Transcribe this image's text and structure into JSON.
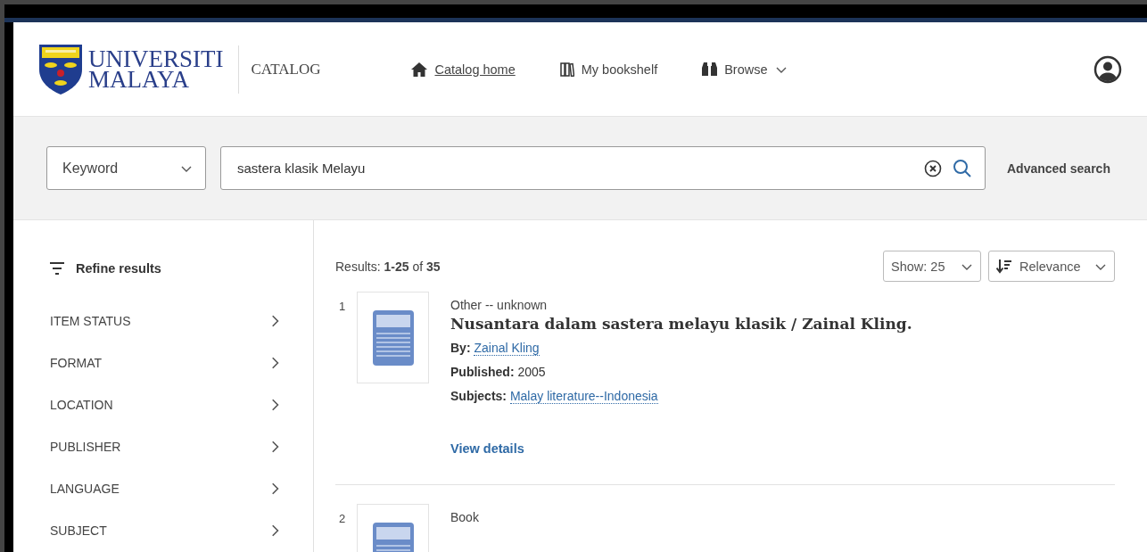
{
  "header": {
    "logo": {
      "line_1": "UNIVERSITI",
      "line_2": "MALAYA"
    },
    "section": "CATALOG",
    "nav": [
      {
        "label": "Catalog home",
        "selected": true,
        "has_menu": false
      },
      {
        "label": "My bookshelf",
        "selected": false,
        "has_menu": false
      },
      {
        "label": "Browse",
        "selected": false,
        "has_menu": true
      }
    ]
  },
  "search": {
    "field_type": "Keyword",
    "query": "sastera klasik Melayu",
    "advanced": "Advanced search"
  },
  "sidebar": {
    "title": "Refine results",
    "facets": [
      {
        "label": "ITEM STATUS",
        "expanded": false
      },
      {
        "label": "FORMAT",
        "expanded": false
      },
      {
        "label": "LOCATION",
        "expanded": false
      },
      {
        "label": "PUBLISHER",
        "expanded": false
      },
      {
        "label": "LANGUAGE",
        "expanded": false
      },
      {
        "label": "SUBJECT",
        "expanded": false
      }
    ]
  },
  "results": {
    "summary": "Results: **1-25** of **35**",
    "show": "Show: 25",
    "sort": "Relevance",
    "items": [
      {
        "number": "1",
        "format": "Other -- unknown",
        "title": "Nusantara dalam sastera melayu klasik / Zainal Kling.",
        "fields": [
          {
            "label": "By:",
            "value": "Zainal Kling",
            "link": true
          },
          {
            "label": "Published:",
            "value": "2005",
            "link": false
          },
          {
            "label": "Subjects:",
            "value": "Malay literature--Indonesia",
            "link": true
          }
        ],
        "action": "View details"
      },
      {
        "number": "2",
        "format": "Book"
      }
    ]
  }
}
